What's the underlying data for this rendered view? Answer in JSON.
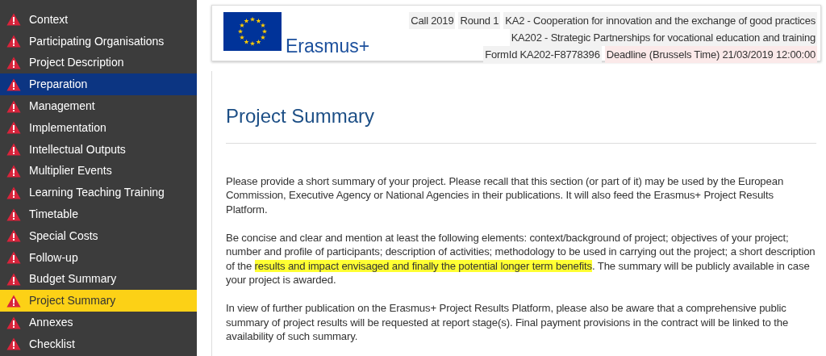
{
  "sidebar": {
    "items": [
      {
        "label": "Context",
        "warning": true,
        "hovered": false,
        "selected": false
      },
      {
        "label": "Participating Organisations",
        "warning": true,
        "hovered": false,
        "selected": false
      },
      {
        "label": "Project Description",
        "warning": true,
        "hovered": false,
        "selected": false
      },
      {
        "label": "Preparation",
        "warning": true,
        "hovered": true,
        "selected": false
      },
      {
        "label": "Management",
        "warning": true,
        "hovered": false,
        "selected": false
      },
      {
        "label": "Implementation",
        "warning": true,
        "hovered": false,
        "selected": false
      },
      {
        "label": "Intellectual Outputs",
        "warning": true,
        "hovered": false,
        "selected": false
      },
      {
        "label": "Multiplier Events",
        "warning": true,
        "hovered": false,
        "selected": false
      },
      {
        "label": "Learning Teaching Training",
        "warning": true,
        "hovered": false,
        "selected": false
      },
      {
        "label": "Timetable",
        "warning": true,
        "hovered": false,
        "selected": false
      },
      {
        "label": "Special Costs",
        "warning": true,
        "hovered": false,
        "selected": false
      },
      {
        "label": "Follow-up",
        "warning": true,
        "hovered": false,
        "selected": false
      },
      {
        "label": "Budget Summary",
        "warning": true,
        "hovered": false,
        "selected": false
      },
      {
        "label": "Project Summary",
        "warning": true,
        "hovered": false,
        "selected": true
      },
      {
        "label": "Annexes",
        "warning": true,
        "hovered": false,
        "selected": false
      },
      {
        "label": "Checklist",
        "warning": true,
        "hovered": false,
        "selected": false
      }
    ]
  },
  "header": {
    "brand": "Erasmus+",
    "lines": [
      [
        {
          "text": "Call 2019",
          "kind": "tag"
        },
        {
          "text": "Round 1",
          "kind": "tag"
        },
        {
          "text": "KA2 - Cooperation for innovation and the exchange of good practices",
          "kind": "tag"
        }
      ],
      [
        {
          "text": "KA202 - Strategic Partnerships for vocational education and training",
          "kind": "tag"
        }
      ],
      [
        {
          "text": "FormId KA202-F8778396",
          "kind": "tag"
        },
        {
          "text": "Deadline (Brussels Time) 21/03/2019 12:00:00",
          "kind": "deadline"
        }
      ]
    ]
  },
  "content": {
    "title": "Project Summary",
    "paragraphs": [
      [
        {
          "text": "Please provide a short summary of your project. Please recall that this section (or part of it) may be used by the European Commission, Executive Agency or National Agencies in their publications. It will also feed the Erasmus+ Project Results Platform.",
          "highlighted": false
        }
      ],
      [
        {
          "text": "Be concise and clear and mention at least the following elements: context/background of project; objectives of your project; number and profile of participants; description of activities; methodology to be used in carrying out the project; a short description of the ",
          "highlighted": false
        },
        {
          "text": "results and impact envisaged and finally the potential longer term benefits",
          "highlighted": true
        },
        {
          "text": ". The summary will be publicly available in case your project is awarded.",
          "highlighted": false
        }
      ],
      [
        {
          "text": "In view of further publication on the Erasmus+ Project Results Platform, please also be aware that a comprehensive public summary of project results will be requested at report stage(s). Final payment provisions in the contract will be linked to the availability of such summary.",
          "highlighted": false
        }
      ]
    ]
  }
}
